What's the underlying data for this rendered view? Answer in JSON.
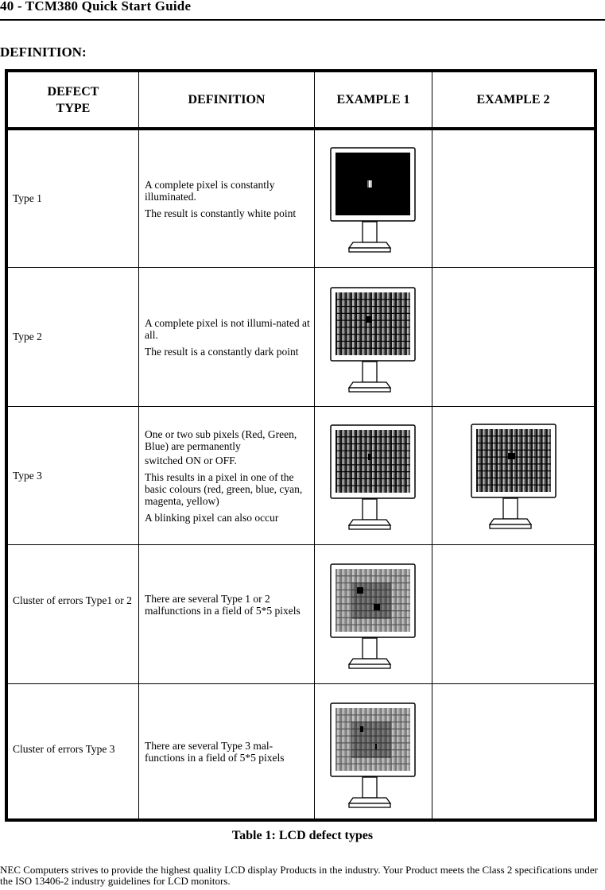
{
  "header": {
    "running_head": "40 - TCM380 Quick Start Guide",
    "section_title": "DEFINITION:"
  },
  "table": {
    "columns": [
      "DEFECT TYPE",
      "DEFINITION",
      "EXAMPLE 1",
      "EXAMPLE 2"
    ],
    "column_lines": {
      "defect_type": [
        "DEFECT",
        "TYPE"
      ]
    },
    "rows": [
      {
        "type": "Type 1",
        "definition": [
          "A complete pixel is constantly illuminated.",
          "The result is constantly white point"
        ],
        "example1": "monitor-black-screen-white-pixel",
        "example2": null
      },
      {
        "type": "Type 2",
        "definition": [
          "A complete pixel is not illumi-nated at all.",
          "The result is a constantly dark point"
        ],
        "example1": "monitor-grid-screen-dark-pixel",
        "example2": null
      },
      {
        "type": "Type 3",
        "definition": [
          "One or two sub pixels (Red, Green, Blue) are permanently",
          "switched ON or OFF.",
          "This results in a pixel in one of the basic colours (red, green, blue, cyan, magenta, yellow)",
          "A blinking pixel can also occur"
        ],
        "example1": "monitor-grid-screen-dark-subpixel",
        "example2": "monitor-grid-screen-dark-pixel"
      },
      {
        "type": "Cluster of errors Type1 or 2",
        "definition": [
          "There are several Type 1 or 2 malfunctions in a field of 5*5 pixels"
        ],
        "example1": "monitor-cluster-two-dark-pixels",
        "example2": null
      },
      {
        "type": "Cluster of errors Type 3",
        "definition": [
          "There are several Type 3 mal-functions in a field of 5*5 pixels"
        ],
        "example1": "monitor-cluster-two-dark-subpixels",
        "example2": null
      }
    ]
  },
  "caption": "Table 1: LCD defect types",
  "footer_text": "NEC Computers strives to provide the highest quality LCD display Products in the industry. Your Product meets the Class 2 specifications under the ISO 13406-2 industry guidelines for LCD monitors."
}
